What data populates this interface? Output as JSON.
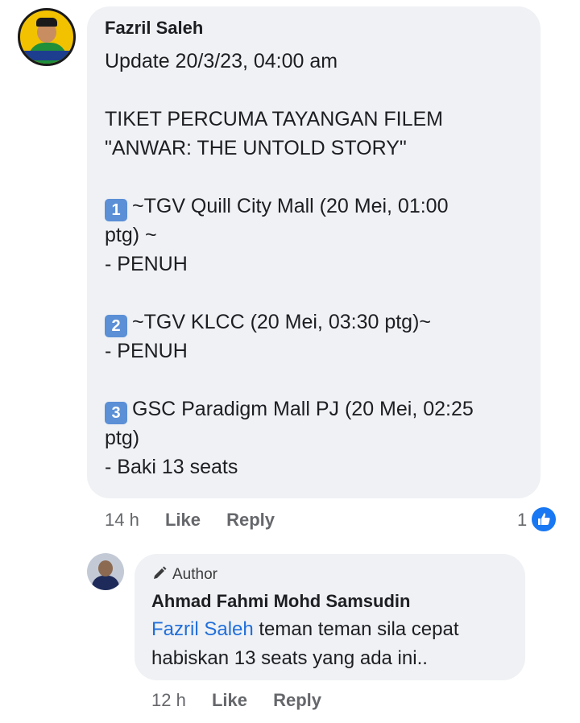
{
  "comment": {
    "author": "Fazril Saleh",
    "lines": [
      "Update 20/3/23, 04:00 am",
      "",
      "TIKET PERCUMA TAYANGAN FILEM",
      "\"ANWAR: THE UNTOLD STORY\"",
      "",
      "~TGV Quill City Mall (20 Mei, 01:00",
      "ptg) ~",
      "- PENUH",
      "",
      "~TGV KLCC (20 Mei, 03:30 ptg)~",
      "- PENUH",
      "",
      "GSC Paradigm Mall PJ (20 Mei, 02:25",
      "ptg)",
      "- Baki 13 seats"
    ],
    "keycaps": [
      "1",
      "2",
      "3"
    ],
    "time": "14 h",
    "like_label": "Like",
    "reply_label": "Reply",
    "reaction_count": "1"
  },
  "reply": {
    "badge": "Author",
    "author": "Ahmad Fahmi Mohd Samsudin",
    "mention": "Fazril Saleh",
    "text_after_mention": " teman teman sila cepat",
    "text_line2": "habiskan 13 seats yang ada ini..",
    "time": "12 h",
    "like_label": "Like",
    "reply_label": "Reply"
  },
  "colors": {
    "bubble": "#eff1f4",
    "mention": "#216fdb",
    "like_blue": "#1877f2",
    "keycap": "#5b8fd6"
  }
}
